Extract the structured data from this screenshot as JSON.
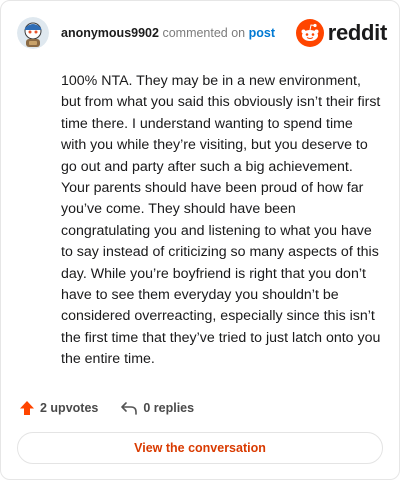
{
  "comment": {
    "author": {
      "username": "anonymous9902",
      "avatar_icon": "snoo-avatar-icon"
    },
    "action_text": "commented on",
    "post_link_label": "post",
    "body": "100% NTA. They may be in a new environment, but from what you said this obviously isn’t their first time there. I understand wanting to spend time with you while they’re visiting, but you deserve to go out and party after such a big achievement. Your parents should have been proud of how far you’ve come. They should have been congratulating you and listening to what you have to say instead of criticizing so many aspects of this day. While you’re boyfriend is right that you don’t have to see them everyday you shouldn’t be considered overreacting, especially since this isn’t the first time that they’ve tried to just latch onto you the entire time.",
    "upvotes_label": "2 upvotes",
    "replies_label": "0 replies"
  },
  "brand": {
    "wordmark": "reddit",
    "logo_icon": "reddit-snoo-logo-icon"
  },
  "cta": {
    "label": "View the conversation"
  },
  "colors": {
    "brand_orange": "#ff4500",
    "link_blue": "#0079d3",
    "cta_text": "#d93a00"
  }
}
